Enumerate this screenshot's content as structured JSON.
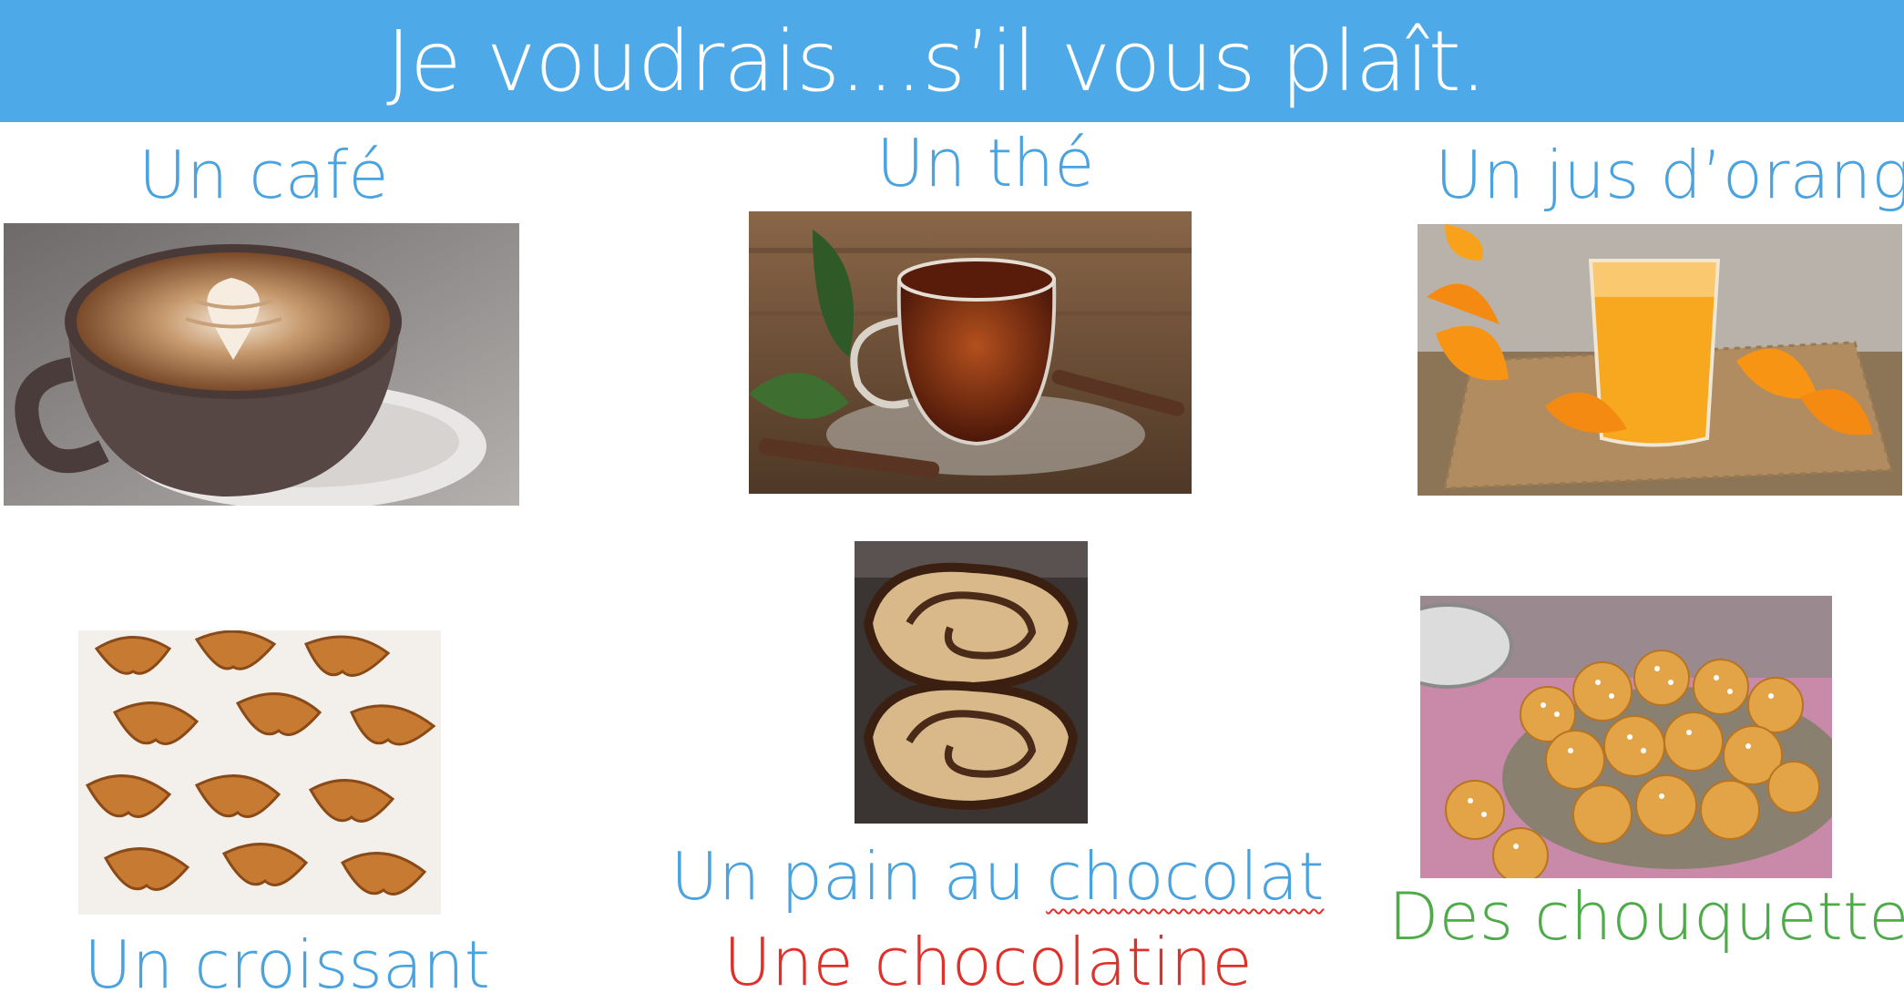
{
  "header": {
    "title": "Je voudrais…s’il vous plaît."
  },
  "items": [
    {
      "label": "Un café",
      "color": "#4aa3df",
      "image_subject": "cappuccino-latte-art"
    },
    {
      "label": "Un thé",
      "color": "#4aa3df",
      "image_subject": "cup-of-tea"
    },
    {
      "label": "Un jus d’orange",
      "color": "#4aa3df",
      "image_subject": "glass-of-orange-juice"
    },
    {
      "label": "Un croissant",
      "color": "#4aa3df",
      "image_subject": "croissants"
    },
    {
      "label_prefix": "Un pain au ",
      "label_underlined": "chocolat",
      "color": "#4aa3df",
      "alt_label": "Une chocolatine",
      "alt_color": "#e0302a",
      "image_subject": "pain-au-chocolat"
    },
    {
      "label": "Des chouquettes",
      "color": "#4faa4a",
      "image_subject": "chouquettes"
    }
  ],
  "colors": {
    "banner": "#4da9e8",
    "label_blue": "#4aa3df",
    "label_red": "#e0302a",
    "label_green": "#4faa4a"
  }
}
